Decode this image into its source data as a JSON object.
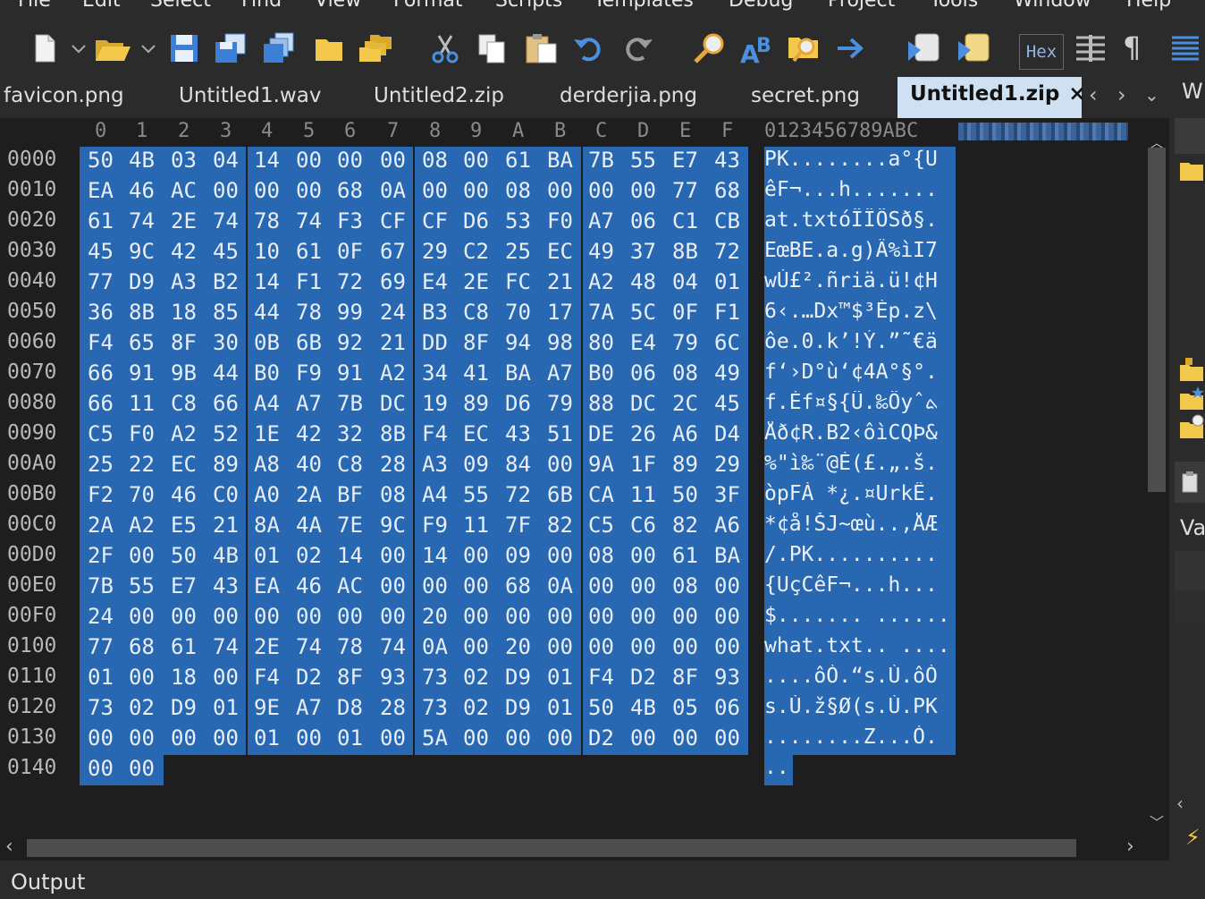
{
  "menu": [
    "File",
    "Edit",
    "Select",
    "Find",
    "View",
    "Format",
    "Scripts",
    "Templates",
    "Debug",
    "Project",
    "Tools",
    "Window",
    "Help"
  ],
  "toolbar": {
    "hex_label": "Hex",
    "pilcrow": "¶",
    "icons": [
      "new-file-icon",
      "dropdown-icon",
      "open-folder-icon",
      "dropdown-icon",
      "save-icon",
      "save-as-icon",
      "save-all-icon",
      "folder-icon",
      "folders-icon",
      "cut-icon",
      "copy-icon",
      "paste-icon",
      "undo-icon",
      "redo-icon",
      "find-icon",
      "replace-icon",
      "find-in-files-icon",
      "goto-icon",
      "script-icon",
      "template-icon",
      "hex-toggle-icon",
      "columns-icon",
      "pilcrow-icon",
      "list-icon"
    ]
  },
  "tabs": [
    {
      "label": "favicon.png",
      "active": false
    },
    {
      "label": "Untitled1.wav",
      "active": false
    },
    {
      "label": "Untitled2.zip",
      "active": false
    },
    {
      "label": "derderjia.png",
      "active": false
    },
    {
      "label": "secret.png",
      "active": false
    },
    {
      "label": "Untitled1.zip",
      "active": true
    }
  ],
  "tab_close": "×",
  "right_tab_label": "W",
  "right_panel_label": "Va",
  "column_headers": [
    "0",
    "1",
    "2",
    "3",
    "4",
    "5",
    "6",
    "7",
    "8",
    "9",
    "A",
    "B",
    "C",
    "D",
    "E",
    "F"
  ],
  "ascii_header": "0123456789ABC",
  "rows": [
    {
      "addr": "0000",
      "bytes": [
        "50",
        "4B",
        "03",
        "04",
        "14",
        "00",
        "00",
        "00",
        "08",
        "00",
        "61",
        "BA",
        "7B",
        "55",
        "E7",
        "43"
      ],
      "ascii": "PK........a°{U"
    },
    {
      "addr": "0010",
      "bytes": [
        "EA",
        "46",
        "AC",
        "00",
        "00",
        "00",
        "68",
        "0A",
        "00",
        "00",
        "08",
        "00",
        "00",
        "00",
        "77",
        "68"
      ],
      "ascii": "êF¬...h......."
    },
    {
      "addr": "0020",
      "bytes": [
        "61",
        "74",
        "2E",
        "74",
        "78",
        "74",
        "F3",
        "CF",
        "CF",
        "D6",
        "53",
        "F0",
        "A7",
        "06",
        "C1",
        "CB"
      ],
      "ascii": "at.txtóÏÏÖSð§."
    },
    {
      "addr": "0030",
      "bytes": [
        "45",
        "9C",
        "42",
        "45",
        "10",
        "61",
        "0F",
        "67",
        "29",
        "C2",
        "25",
        "EC",
        "49",
        "37",
        "8B",
        "72"
      ],
      "ascii": "EœBE.a.g)Â%ìI7"
    },
    {
      "addr": "0040",
      "bytes": [
        "77",
        "D9",
        "A3",
        "B2",
        "14",
        "F1",
        "72",
        "69",
        "E4",
        "2E",
        "FC",
        "21",
        "A2",
        "48",
        "04",
        "01"
      ],
      "ascii": "wÙ£².ñriä.ü!¢H"
    },
    {
      "addr": "0050",
      "bytes": [
        "36",
        "8B",
        "18",
        "85",
        "44",
        "78",
        "99",
        "24",
        "B3",
        "C8",
        "70",
        "17",
        "7A",
        "5C",
        "0F",
        "F1"
      ],
      "ascii": "6‹.…Dx™$³Èp.z\\"
    },
    {
      "addr": "0060",
      "bytes": [
        "F4",
        "65",
        "8F",
        "30",
        "0B",
        "6B",
        "92",
        "21",
        "DD",
        "8F",
        "94",
        "98",
        "80",
        "E4",
        "79",
        "6C"
      ],
      "ascii": "ôe.0.k’!Ý.”˜€ä"
    },
    {
      "addr": "0070",
      "bytes": [
        "66",
        "91",
        "9B",
        "44",
        "B0",
        "F9",
        "91",
        "A2",
        "34",
        "41",
        "BA",
        "A7",
        "B0",
        "06",
        "08",
        "49"
      ],
      "ascii": "f‘›D°ù‘¢4A°§°."
    },
    {
      "addr": "0080",
      "bytes": [
        "66",
        "11",
        "C8",
        "66",
        "A4",
        "A7",
        "7B",
        "DC",
        "19",
        "89",
        "D6",
        "79",
        "88",
        "DC",
        "2C",
        "45"
      ],
      "ascii": "f.Èf¤§{Ü.‰Öyˆܬ"
    },
    {
      "addr": "0090",
      "bytes": [
        "C5",
        "F0",
        "A2",
        "52",
        "1E",
        "42",
        "32",
        "8B",
        "F4",
        "EC",
        "43",
        "51",
        "DE",
        "26",
        "A6",
        "D4"
      ],
      "ascii": "Åð¢R.B2‹ôìCQÞ&"
    },
    {
      "addr": "00A0",
      "bytes": [
        "25",
        "22",
        "EC",
        "89",
        "A8",
        "40",
        "C8",
        "28",
        "A3",
        "09",
        "84",
        "00",
        "9A",
        "1F",
        "89",
        "29"
      ],
      "ascii": "%\"ì‰¨@È(£.„.š."
    },
    {
      "addr": "00B0",
      "bytes": [
        "F2",
        "70",
        "46",
        "C0",
        "A0",
        "2A",
        "BF",
        "08",
        "A4",
        "55",
        "72",
        "6B",
        "CA",
        "11",
        "50",
        "3F"
      ],
      "ascii": "òpFÀ *¿.¤UrkÊ."
    },
    {
      "addr": "00C0",
      "bytes": [
        "2A",
        "A2",
        "E5",
        "21",
        "8A",
        "4A",
        "7E",
        "9C",
        "F9",
        "11",
        "7F",
        "82",
        "C5",
        "C6",
        "82",
        "A6"
      ],
      "ascii": "*¢å!ŠJ~œù..‚ÅÆ"
    },
    {
      "addr": "00D0",
      "bytes": [
        "2F",
        "00",
        "50",
        "4B",
        "01",
        "02",
        "14",
        "00",
        "14",
        "00",
        "09",
        "00",
        "08",
        "00",
        "61",
        "BA"
      ],
      "ascii": "/.PK.........."
    },
    {
      "addr": "00E0",
      "bytes": [
        "7B",
        "55",
        "E7",
        "43",
        "EA",
        "46",
        "AC",
        "00",
        "00",
        "00",
        "68",
        "0A",
        "00",
        "00",
        "08",
        "00"
      ],
      "ascii": "{UçCêF¬...h..."
    },
    {
      "addr": "00F0",
      "bytes": [
        "24",
        "00",
        "00",
        "00",
        "00",
        "00",
        "00",
        "00",
        "20",
        "00",
        "00",
        "00",
        "00",
        "00",
        "00",
        "00"
      ],
      "ascii": "$....... ......"
    },
    {
      "addr": "0100",
      "bytes": [
        "77",
        "68",
        "61",
        "74",
        "2E",
        "74",
        "78",
        "74",
        "0A",
        "00",
        "20",
        "00",
        "00",
        "00",
        "00",
        "00"
      ],
      "ascii": "what.txt.. ...."
    },
    {
      "addr": "0110",
      "bytes": [
        "01",
        "00",
        "18",
        "00",
        "F4",
        "D2",
        "8F",
        "93",
        "73",
        "02",
        "D9",
        "01",
        "F4",
        "D2",
        "8F",
        "93"
      ],
      "ascii": "....ôÒ.“s.Ù.ôÒ"
    },
    {
      "addr": "0120",
      "bytes": [
        "73",
        "02",
        "D9",
        "01",
        "9E",
        "A7",
        "D8",
        "28",
        "73",
        "02",
        "D9",
        "01",
        "50",
        "4B",
        "05",
        "06"
      ],
      "ascii": "s.Ù.ž§Ø(s.Ù.PK"
    },
    {
      "addr": "0130",
      "bytes": [
        "00",
        "00",
        "00",
        "00",
        "01",
        "00",
        "01",
        "00",
        "5A",
        "00",
        "00",
        "00",
        "D2",
        "00",
        "00",
        "00"
      ],
      "ascii": "........Z...Ò."
    },
    {
      "addr": "0140",
      "bytes": [
        "00",
        "00"
      ],
      "ascii": ".."
    }
  ],
  "output_label": "Output",
  "colors": {
    "selection": "#2867b2",
    "active_tab": "#cfe0f3",
    "background": "#1e1e1e",
    "chrome": "#2b2b2b"
  }
}
